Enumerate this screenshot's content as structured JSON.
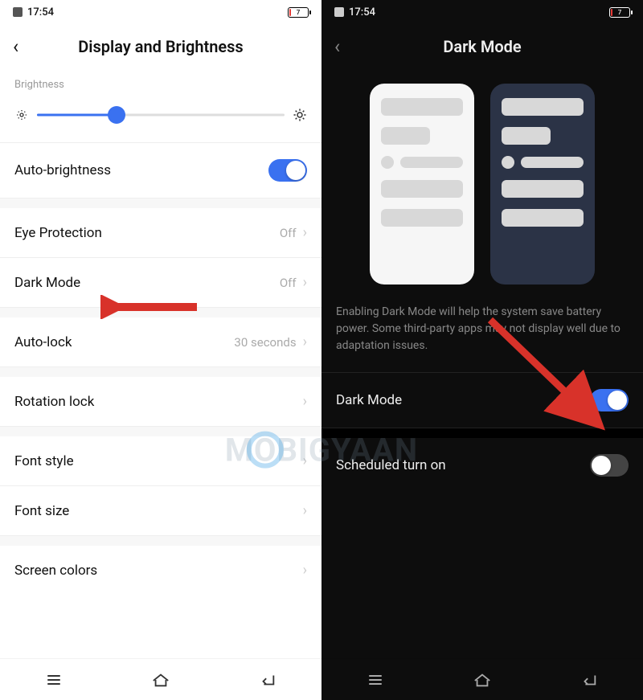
{
  "status": {
    "time": "17:54",
    "battery_text": "7"
  },
  "left": {
    "title": "Display and Brightness",
    "section_brightness": "Brightness",
    "auto_brightness": {
      "label": "Auto-brightness",
      "on": true
    },
    "eye_protection": {
      "label": "Eye Protection",
      "value": "Off"
    },
    "dark_mode_row": {
      "label": "Dark Mode",
      "value": "Off"
    },
    "auto_lock": {
      "label": "Auto-lock",
      "value": "30 seconds"
    },
    "rotation_lock": {
      "label": "Rotation lock"
    },
    "font_style": {
      "label": "Font style"
    },
    "font_size": {
      "label": "Font size"
    },
    "screen_colors": {
      "label": "Screen colors"
    }
  },
  "right": {
    "title": "Dark Mode",
    "description": "Enabling Dark Mode will help the system save battery power. Some third-party apps may not display well due to adaptation issues.",
    "dark_mode_toggle": {
      "label": "Dark Mode",
      "on": true
    },
    "scheduled": {
      "label": "Scheduled turn on",
      "on": false
    }
  },
  "watermark": "MOBIGYAAN"
}
